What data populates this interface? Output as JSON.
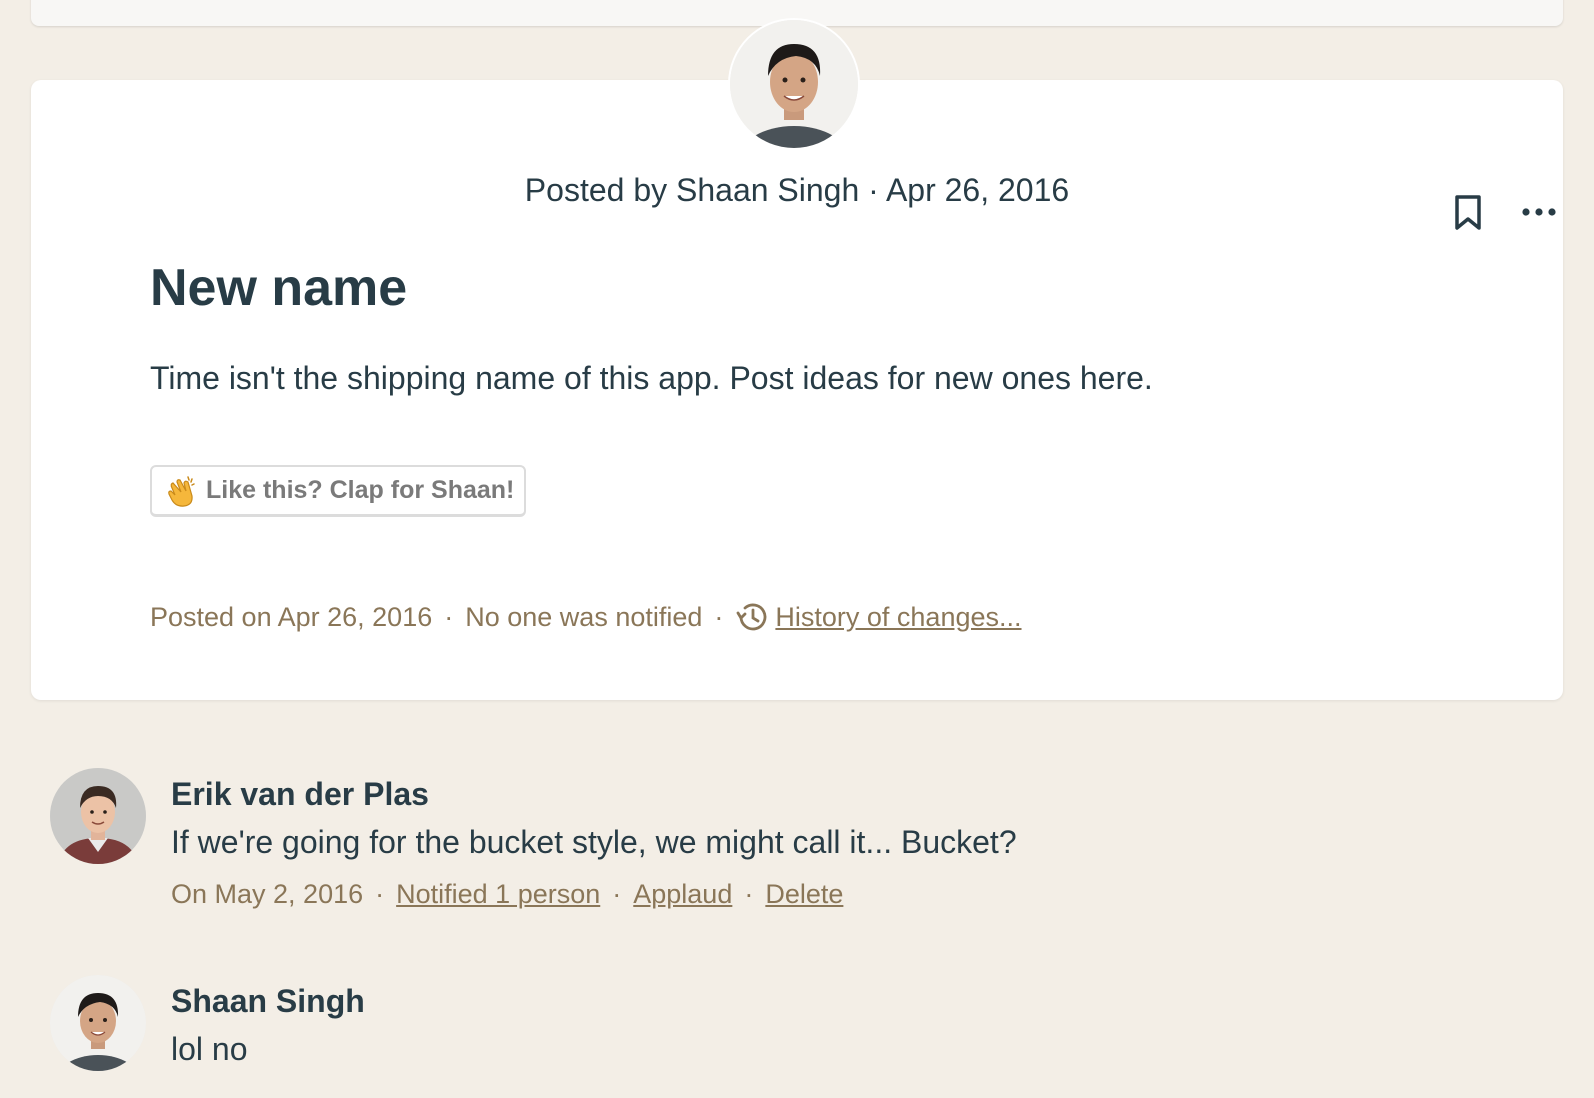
{
  "post": {
    "posted_by": "Posted by Shaan Singh · Apr 26, 2016",
    "title": "New name",
    "body": "Time isn't the shipping name of this app. Post ideas for new ones here.",
    "clap_label": "Like this? Clap for Shaan!",
    "posted_on": "Posted on Apr 26, 2016",
    "notified": "No one was notified",
    "history_link": "History of changes...",
    "separator": "·"
  },
  "icons": {
    "bookmark": "bookmark-icon",
    "more": "more-icon",
    "clap": "clapping-hands-icon",
    "history": "history-icon"
  },
  "colors": {
    "background": "#f3eee6",
    "card": "#ffffff",
    "text": "#283c46",
    "meta": "#8a7658"
  },
  "comments": [
    {
      "author": "Erik van der Plas",
      "text": "If we're going for the bucket style, we might call it... Bucket?",
      "date": "On May 2, 2016",
      "notified": "Notified 1 person",
      "applaud": "Applaud",
      "delete": "Delete"
    },
    {
      "author": "Shaan Singh",
      "text": "lol no"
    }
  ]
}
